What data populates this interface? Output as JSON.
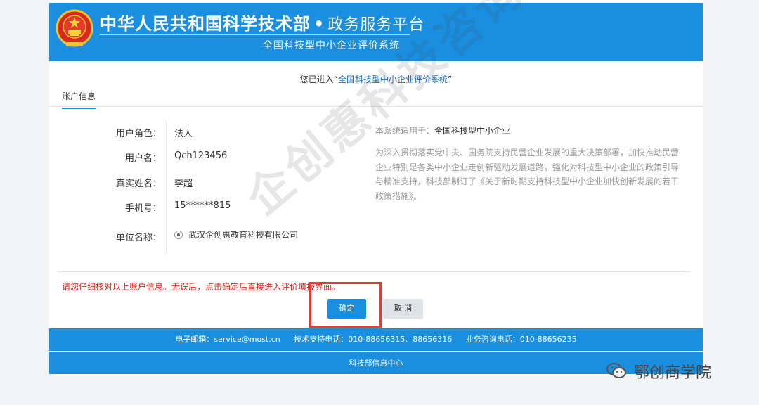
{
  "header": {
    "title": "中华人民共和国科学技术部",
    "separator": "•",
    "subtitle": "政务服务平台",
    "system_name": "全国科技型中小企业评价系统"
  },
  "entered": {
    "prefix": "您已进入“",
    "system": "全国科技型中小企业评价系统",
    "suffix": "”"
  },
  "tab": {
    "label": "账户信息"
  },
  "account": {
    "role_label": "用户角色：",
    "role_value": "法人",
    "username_label": "用户名：",
    "username_value": "Qch123456",
    "realname_label": "真实姓名：",
    "realname_value": "李超",
    "phone_label": "手机号：",
    "phone_value": "15******815",
    "unit_label": "单位名称：",
    "unit_value": "武汉企创惠教育科技有限公司"
  },
  "notice": {
    "head_prefix": "本系统适用于：",
    "head_strong": "全国科技型中小企业",
    "body": "为深入贯彻落实党中央、国务院支持民营企业发展的重大决策部署，加快推动民营企业特别是各类中小企业走创新驱动发展道路，强化对科技型中小企业的政策引导与精准支持，科技部制订了《关于新时期支持科技型中小企业加快创新发展的若干政策措施》。"
  },
  "warning": "请您仔细核对以上账户信息。无误后，点击确定后直接进入评价填报界面。",
  "buttons": {
    "ok": "确定",
    "cancel": "取 消"
  },
  "footer": {
    "email": "电子邮箱：service@most.cn",
    "support": "技术支持电话：010-88656315、88656316",
    "business": "业务咨询电话：010-88656235",
    "center": "科技部信息中心"
  },
  "watermark": "企创惠科技咨询",
  "wechat_brand": "鄂创商学院",
  "colors": {
    "brand_blue": "#1a8fe0",
    "warning_red": "#d9231d",
    "highlight": "#e53935"
  }
}
